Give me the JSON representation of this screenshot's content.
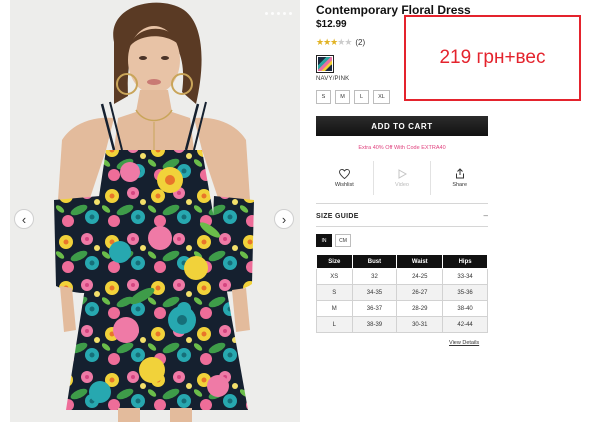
{
  "product": {
    "title": "Contemporary Floral Dress",
    "price": "$12.99",
    "rating_stars": 3,
    "rating_max": 5,
    "review_count": "(2)",
    "color_name": "NAVY/PINK",
    "sizes": [
      "S",
      "M",
      "L",
      "XL"
    ]
  },
  "annotation": {
    "price_note": "219 грн+вес",
    "border_color": "#e4232d"
  },
  "cart": {
    "add_label": "ADD TO CART"
  },
  "promo": {
    "text": "Extra 40% Off With Code EXTRA40",
    "color": "#e0427e"
  },
  "actions": {
    "wishlist": "Wishlist",
    "video": "Video",
    "share": "Share"
  },
  "size_guide": {
    "title": "SIZE GUIDE",
    "toggle_icon": "–",
    "units": [
      "IN",
      "CM"
    ],
    "active_unit": "IN",
    "headers": [
      "Size",
      "Bust",
      "Waist",
      "Hips"
    ],
    "rows": [
      [
        "XS",
        "32",
        "24-25",
        "33-34"
      ],
      [
        "S",
        "34-35",
        "26-27",
        "35-36"
      ],
      [
        "M",
        "36-37",
        "28-29",
        "38-40"
      ],
      [
        "L",
        "38-39",
        "30-31",
        "42-44"
      ]
    ],
    "view_details": "View Details"
  },
  "gallery": {
    "prev_icon": "‹",
    "next_icon": "›",
    "dot_count": 5
  }
}
